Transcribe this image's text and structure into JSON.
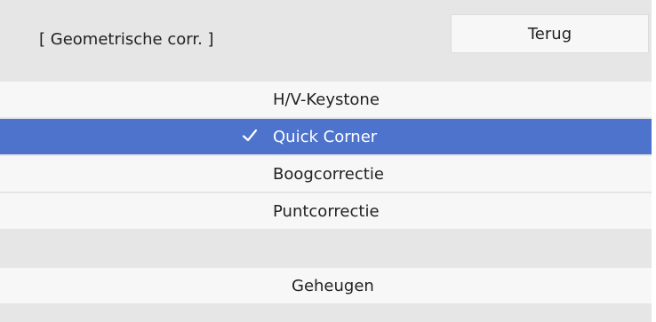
{
  "header": {
    "title": "[ Geometrische corr. ]",
    "back_label": "Terug"
  },
  "menu": {
    "items": [
      {
        "label": "H/V-Keystone",
        "selected": false
      },
      {
        "label": "Quick Corner",
        "selected": true
      },
      {
        "label": "Boogcorrectie",
        "selected": false
      },
      {
        "label": "Puntcorrectie",
        "selected": false
      }
    ],
    "memory_label": "Geheugen"
  },
  "colors": {
    "background": "#e6e6e6",
    "item_background": "#f7f7f7",
    "selected_background": "#4d73cc",
    "selected_text": "#ffffff",
    "text": "#222222"
  },
  "icons": {
    "selected_marker": "check-icon"
  }
}
